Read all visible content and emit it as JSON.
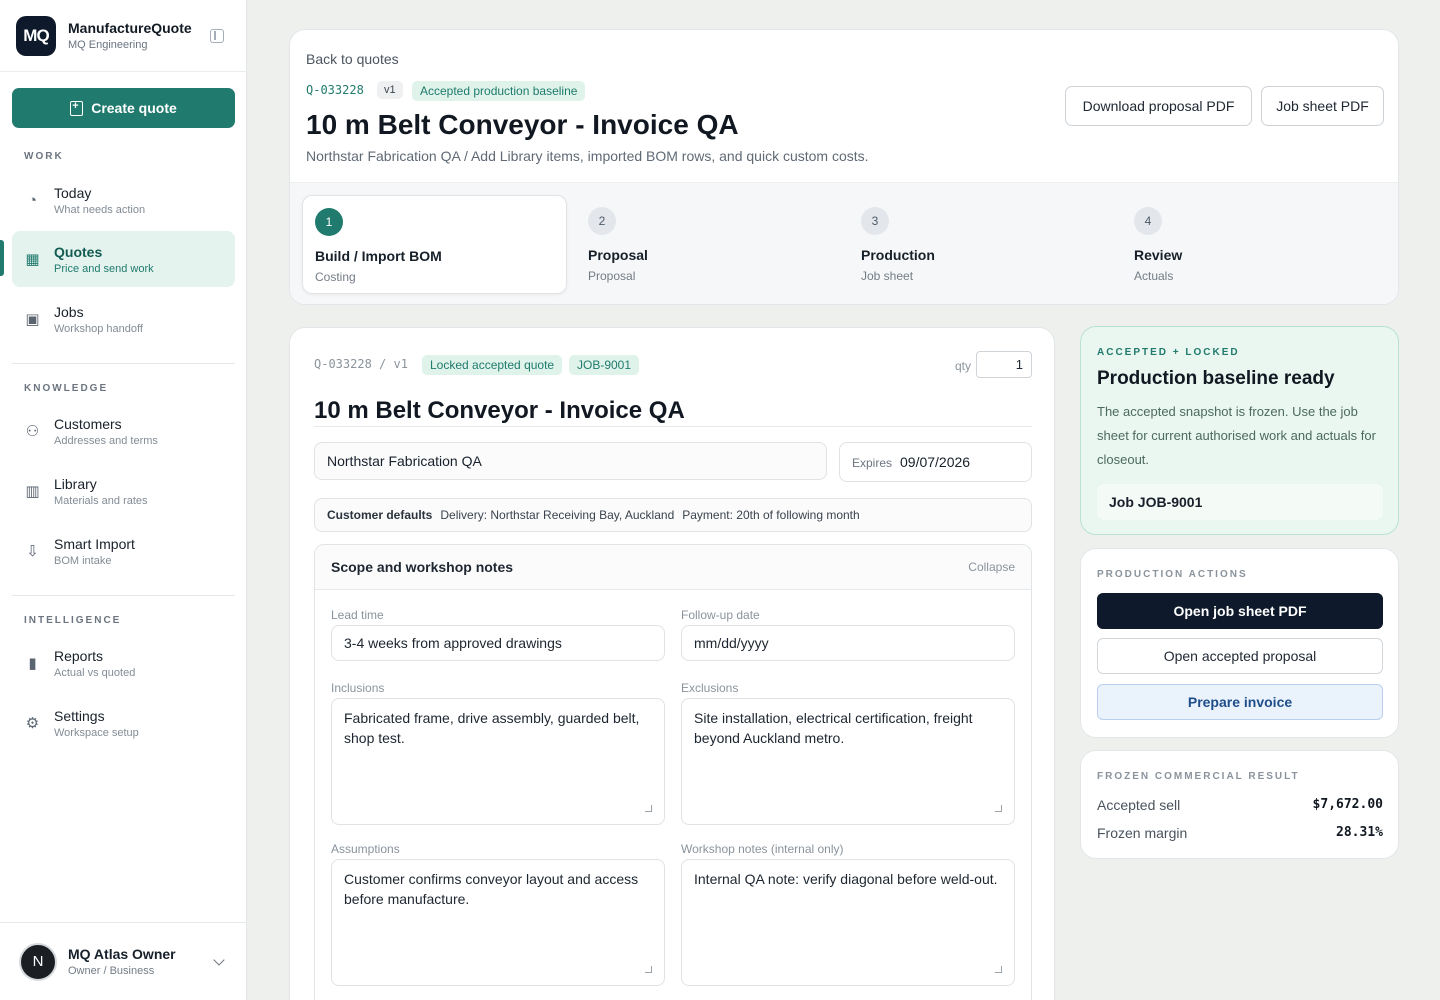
{
  "app": {
    "name": "ManufactureQuote",
    "org": "MQ Engineering",
    "logo_text": "MQ"
  },
  "sidebar": {
    "create_label": "Create quote",
    "sections": {
      "work": "WORK",
      "knowledge": "KNOWLEDGE",
      "intelligence": "INTELLIGENCE"
    },
    "items": [
      {
        "title": "Today",
        "sub": "What needs action",
        "icon": "gauge-icon"
      },
      {
        "title": "Quotes",
        "sub": "Price and send work",
        "icon": "calculator-icon"
      },
      {
        "title": "Jobs",
        "sub": "Workshop handoff",
        "icon": "briefcase-icon"
      },
      {
        "title": "Customers",
        "sub": "Addresses and terms",
        "icon": "users-icon"
      },
      {
        "title": "Library",
        "sub": "Materials and rates",
        "icon": "library-icon"
      },
      {
        "title": "Smart Import",
        "sub": "BOM intake",
        "icon": "import-icon"
      },
      {
        "title": "Reports",
        "sub": "Actual vs quoted",
        "icon": "bar-chart-icon"
      },
      {
        "title": "Settings",
        "sub": "Workspace setup",
        "icon": "gear-icon"
      }
    ],
    "user": {
      "initial": "N",
      "name": "MQ Atlas Owner",
      "role": "Owner / Business"
    }
  },
  "header": {
    "back": "Back to quotes",
    "quote_id": "Q-033228",
    "version": "v1",
    "status": "Accepted production baseline",
    "title": "10 m Belt Conveyor - Invoice QA",
    "subtitle": "Northstar Fabrication QA / Add Library items, imported BOM rows, and quick custom costs.",
    "download_pdf": "Download proposal PDF",
    "job_sheet_pdf": "Job sheet PDF",
    "steps": [
      {
        "num": "1",
        "title": "Build / Import BOM",
        "sub": "Costing"
      },
      {
        "num": "2",
        "title": "Proposal",
        "sub": "Proposal"
      },
      {
        "num": "3",
        "title": "Production",
        "sub": "Job sheet"
      },
      {
        "num": "4",
        "title": "Review",
        "sub": "Actuals"
      }
    ]
  },
  "quote": {
    "ref": "Q-033228 / v1",
    "locked_badge": "Locked accepted quote",
    "job_badge": "JOB-9001",
    "qty_label": "qty",
    "qty": "1",
    "title": "10 m Belt Conveyor - Invoice QA",
    "customer": "Northstar Fabrication QA",
    "expires_label": "Expires",
    "expires": "09/07/2026",
    "defaults_label": "Customer defaults",
    "delivery": "Delivery: Northstar Receiving Bay, Auckland",
    "payment": "Payment: 20th of following month",
    "scope": {
      "title": "Scope and workshop notes",
      "collapse": "Collapse",
      "lead_time_label": "Lead time",
      "lead_time": "3-4 weeks from approved drawings",
      "followup_label": "Follow-up date",
      "followup_placeholder": "mm/dd/yyyy",
      "inclusions_label": "Inclusions",
      "inclusions": "Fabricated frame, drive assembly, guarded belt, shop test.",
      "exclusions_label": "Exclusions",
      "exclusions": "Site installation, electrical certification, freight beyond Auckland metro.",
      "assumptions_label": "Assumptions",
      "assumptions": "Customer confirms conveyor layout and access before manufacture.",
      "workshop_label": "Workshop notes (internal only)",
      "workshop": "Internal QA note: verify diagonal before weld-out."
    }
  },
  "baseline": {
    "eyebrow": "ACCEPTED + LOCKED",
    "title": "Production baseline ready",
    "text": "The accepted snapshot is frozen. Use the job sheet for current authorised work and actuals for closeout.",
    "job": "Job JOB-9001"
  },
  "actions": {
    "eyebrow": "PRODUCTION ACTIONS",
    "open_job_sheet": "Open job sheet PDF",
    "open_proposal": "Open accepted proposal",
    "prepare_invoice": "Prepare invoice"
  },
  "result": {
    "eyebrow": "FROZEN COMMERCIAL RESULT",
    "sell_label": "Accepted sell",
    "sell": "$7,672.00",
    "margin_label": "Frozen margin",
    "margin": "28.31%"
  },
  "colors": {
    "accent": "#207a6d",
    "dark": "#0e1a2b",
    "mint": "#e9f7f0",
    "invoice_bg": "#eaf2fc"
  }
}
